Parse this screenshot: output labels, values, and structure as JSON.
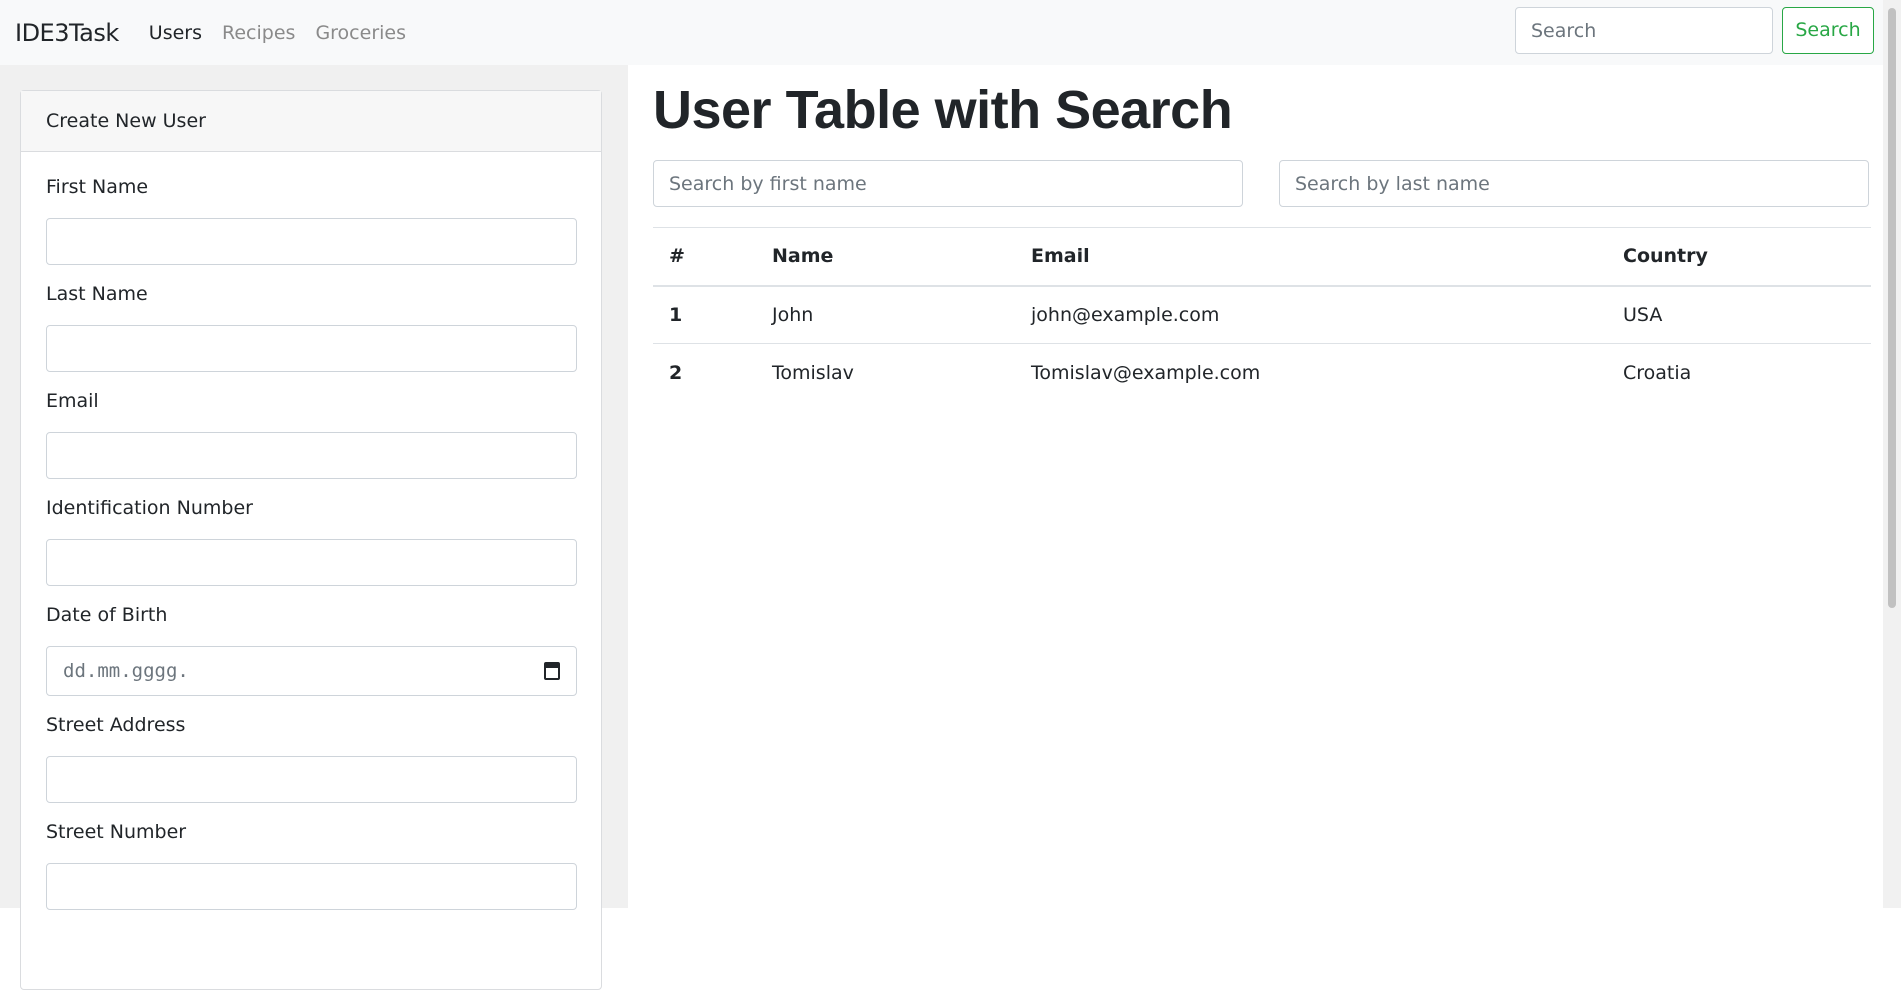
{
  "navbar": {
    "brand": "IDE3Task",
    "links": [
      {
        "label": "Users",
        "active": true
      },
      {
        "label": "Recipes",
        "active": false
      },
      {
        "label": "Groceries",
        "active": false
      }
    ],
    "search": {
      "placeholder": "Search",
      "value": ""
    },
    "search_button": "Search",
    "accent_color": "#28a745"
  },
  "form": {
    "title": "Create New User",
    "fields": {
      "first_name": {
        "label": "First Name",
        "value": ""
      },
      "last_name": {
        "label": "Last Name",
        "value": ""
      },
      "email": {
        "label": "Email",
        "value": ""
      },
      "id_number": {
        "label": "Identification Number",
        "value": ""
      },
      "dob": {
        "label": "Date of Birth",
        "placeholder": "dd.mm.gggg."
      },
      "street_address": {
        "label": "Street Address",
        "value": ""
      },
      "street_number": {
        "label": "Street Number",
        "value": ""
      }
    }
  },
  "main": {
    "title": "User Table with Search",
    "first_name_filter": {
      "placeholder": "Search by first name"
    },
    "last_name_filter": {
      "placeholder": "Search by last name"
    },
    "table": {
      "headers": [
        "#",
        "Name",
        "Email",
        "Country"
      ],
      "rows": [
        {
          "id": "1",
          "name": "John",
          "email": "john@example.com",
          "country": "USA"
        },
        {
          "id": "2",
          "name": "Tomislav",
          "email": "Tomislav@example.com",
          "country": "Croatia"
        }
      ]
    }
  }
}
